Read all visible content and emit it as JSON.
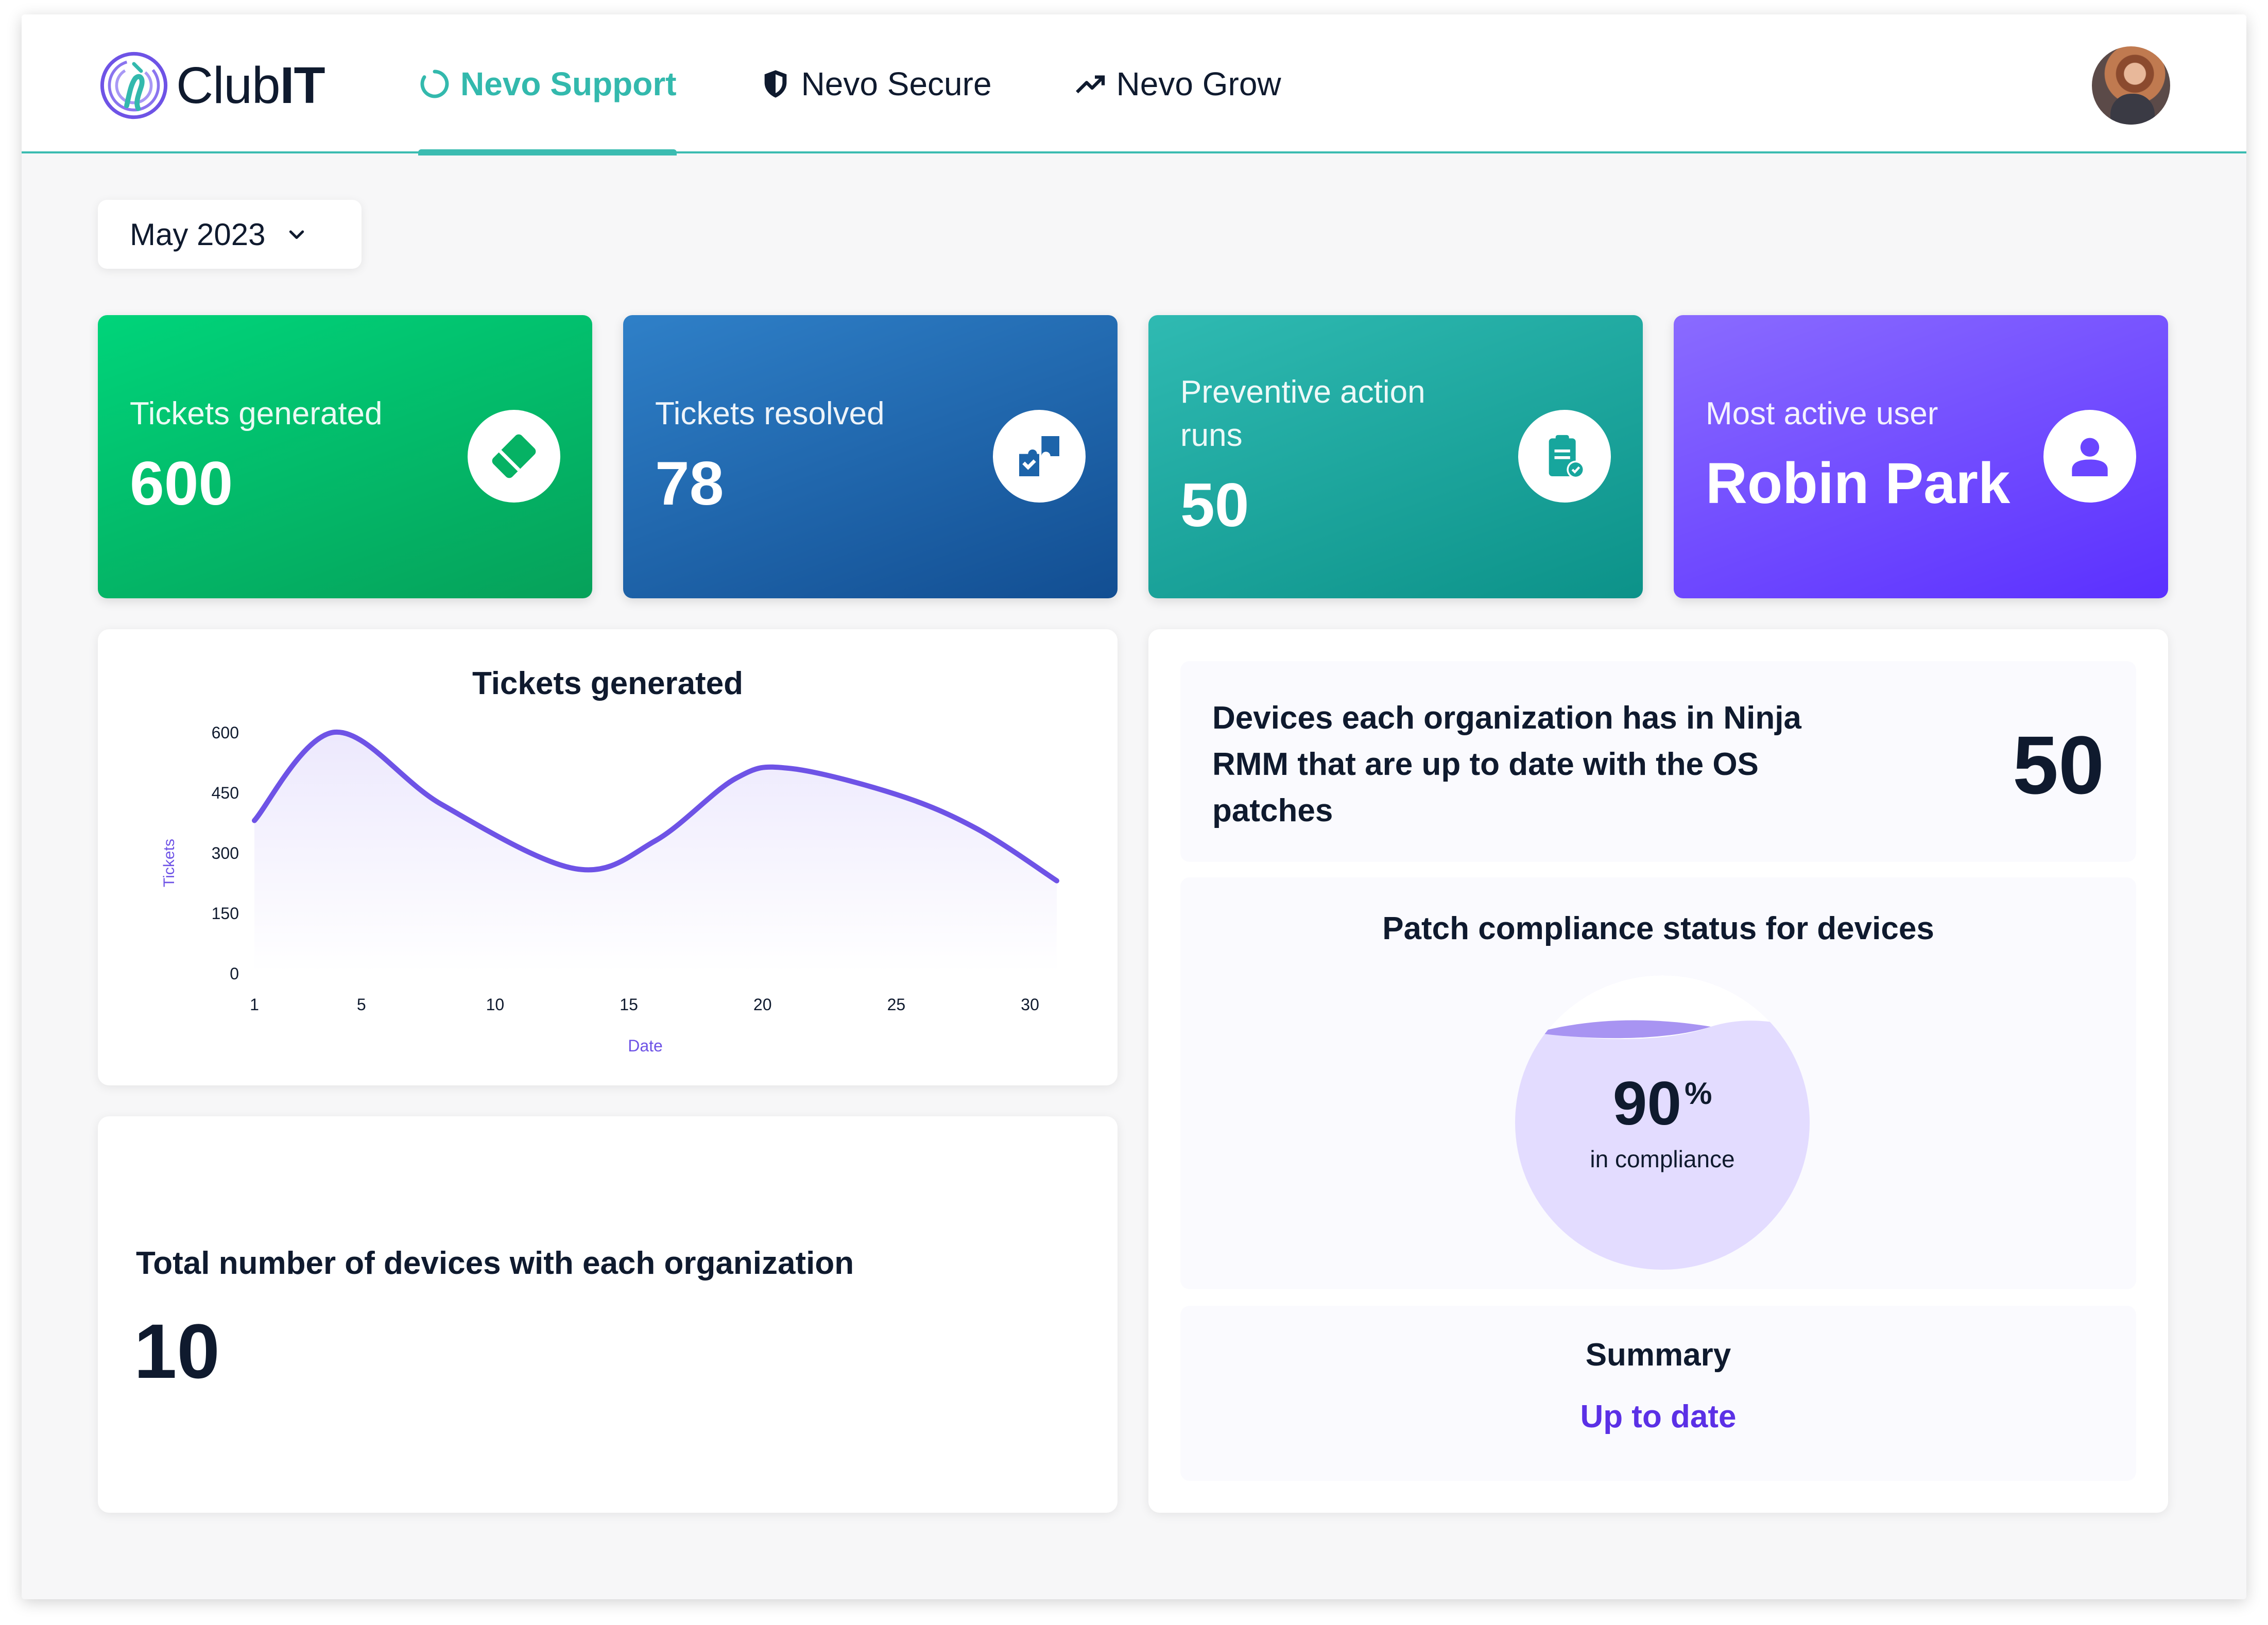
{
  "brand": {
    "name_prefix": "Club",
    "name_suffix": "IT"
  },
  "nav": [
    {
      "label": "Nevo Support",
      "icon": "refresh-circle-icon",
      "active": true
    },
    {
      "label": "Nevo Secure",
      "icon": "shield-icon",
      "active": false
    },
    {
      "label": "Nevo Grow",
      "icon": "trending-up-icon",
      "active": false
    }
  ],
  "month_selector": {
    "value": "May 2023"
  },
  "stats": [
    {
      "label": "Tickets generated",
      "value": "600",
      "icon": "ticket-icon",
      "color": "#06b264"
    },
    {
      "label": "Tickets resolved",
      "value": "78",
      "icon": "puzzle-icon",
      "color": "#1d64aa"
    },
    {
      "label": "Preventive action runs",
      "value": "50",
      "icon": "clipboard-check-icon",
      "color": "#17a69d"
    },
    {
      "label": "Most active user",
      "value": "Robin Park",
      "icon": "user-icon",
      "color": "#6a45ff"
    }
  ],
  "tickets_chart": {
    "title": "Tickets generated",
    "chart_data": {
      "type": "area",
      "title": "Tickets generated",
      "xlabel": "Date",
      "ylabel": "Tickets",
      "xlim": [
        1,
        31
      ],
      "ylim": [
        0,
        600
      ],
      "x_ticks": [
        "1",
        "5",
        "10",
        "15",
        "20",
        "25",
        "30"
      ],
      "y_ticks": [
        "0",
        "150",
        "300",
        "450",
        "600"
      ],
      "grid": false,
      "series": [
        {
          "color": "#6e53e6",
          "x": [
            1,
            4,
            8,
            13,
            16,
            19,
            21,
            25,
            28,
            31
          ],
          "y": [
            380,
            600,
            420,
            260,
            330,
            485,
            510,
            445,
            360,
            230
          ]
        }
      ]
    }
  },
  "devices_total": {
    "title": "Total number of devices with each organization",
    "value": "10"
  },
  "os_patches": {
    "question": "Devices each organization has in Ninja RMM that are up to date with the OS patches",
    "value": "50"
  },
  "patch_compliance": {
    "title": "Patch compliance status for devices",
    "percent": "90",
    "percent_sign": "%",
    "caption": "in compliance",
    "fill": 0.9
  },
  "summary": {
    "title": "Summary",
    "value": "Up to date"
  }
}
